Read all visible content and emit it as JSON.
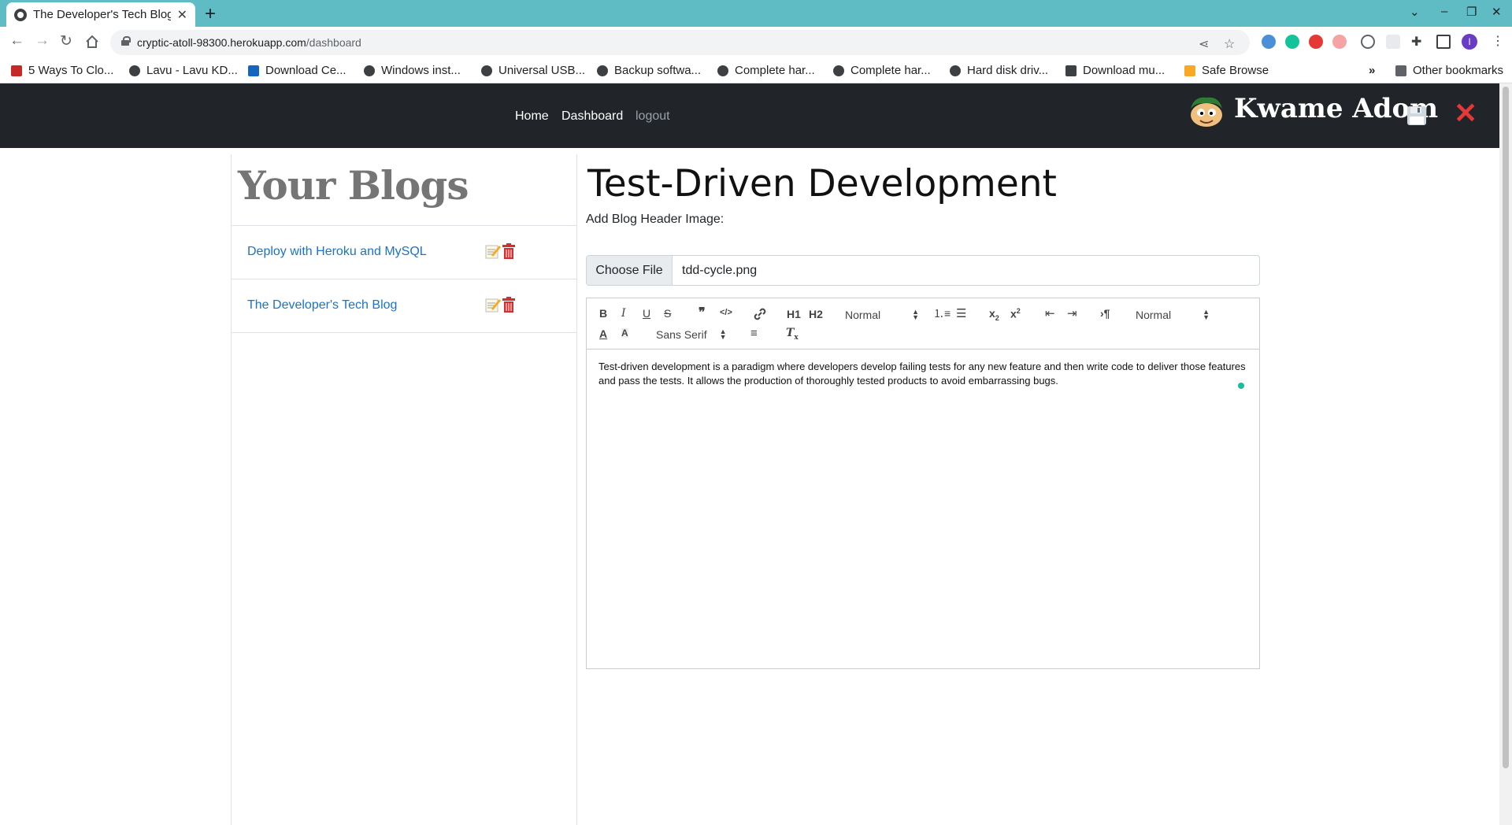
{
  "browser": {
    "tab_title": "The Developer's Tech Blog",
    "url_host": "cryptic-atoll-98300.herokuapp.com",
    "url_path": "/dashboard",
    "profile_initial": "I",
    "bookmarks": [
      "5 Ways To Clo...",
      "Lavu - Lavu KD...",
      "Download Ce...",
      "Windows inst...",
      "Universal USB...",
      "Backup softwa...",
      "Complete har...",
      "Complete har...",
      "Hard disk driv...",
      "Download mu...",
      "Safe Browse"
    ],
    "other_bookmarks": "Other bookmarks"
  },
  "nav": {
    "home": "Home",
    "dashboard": "Dashboard",
    "logout": "logout",
    "user_name": "Kwame Adom"
  },
  "sidebar": {
    "heading": "Your Blogs",
    "blogs": [
      {
        "title": "Deploy with Heroku and MySQL"
      },
      {
        "title": "The Developer's Tech Blog"
      }
    ]
  },
  "post": {
    "title": "Test-Driven Development",
    "header_image_label": "Add Blog Header Image:",
    "choose_file_label": "Choose File",
    "file_name": "tdd-cycle.png",
    "content": "Test-driven development is a paradigm where developers develop failing tests for any new feature and then write code to deliver those features and pass the tests. It allows the production of thoroughly tested products to avoid embarrassing bugs."
  },
  "editor_toolbar": {
    "header_select": "Normal",
    "size_select": "Normal",
    "font_select": "Sans Serif",
    "h1": "H1",
    "h2": "H2"
  },
  "colors": {
    "tabbar": "#5fbcc4",
    "navbar": "#212529",
    "link": "#1a73c8",
    "delete": "#e53935"
  }
}
